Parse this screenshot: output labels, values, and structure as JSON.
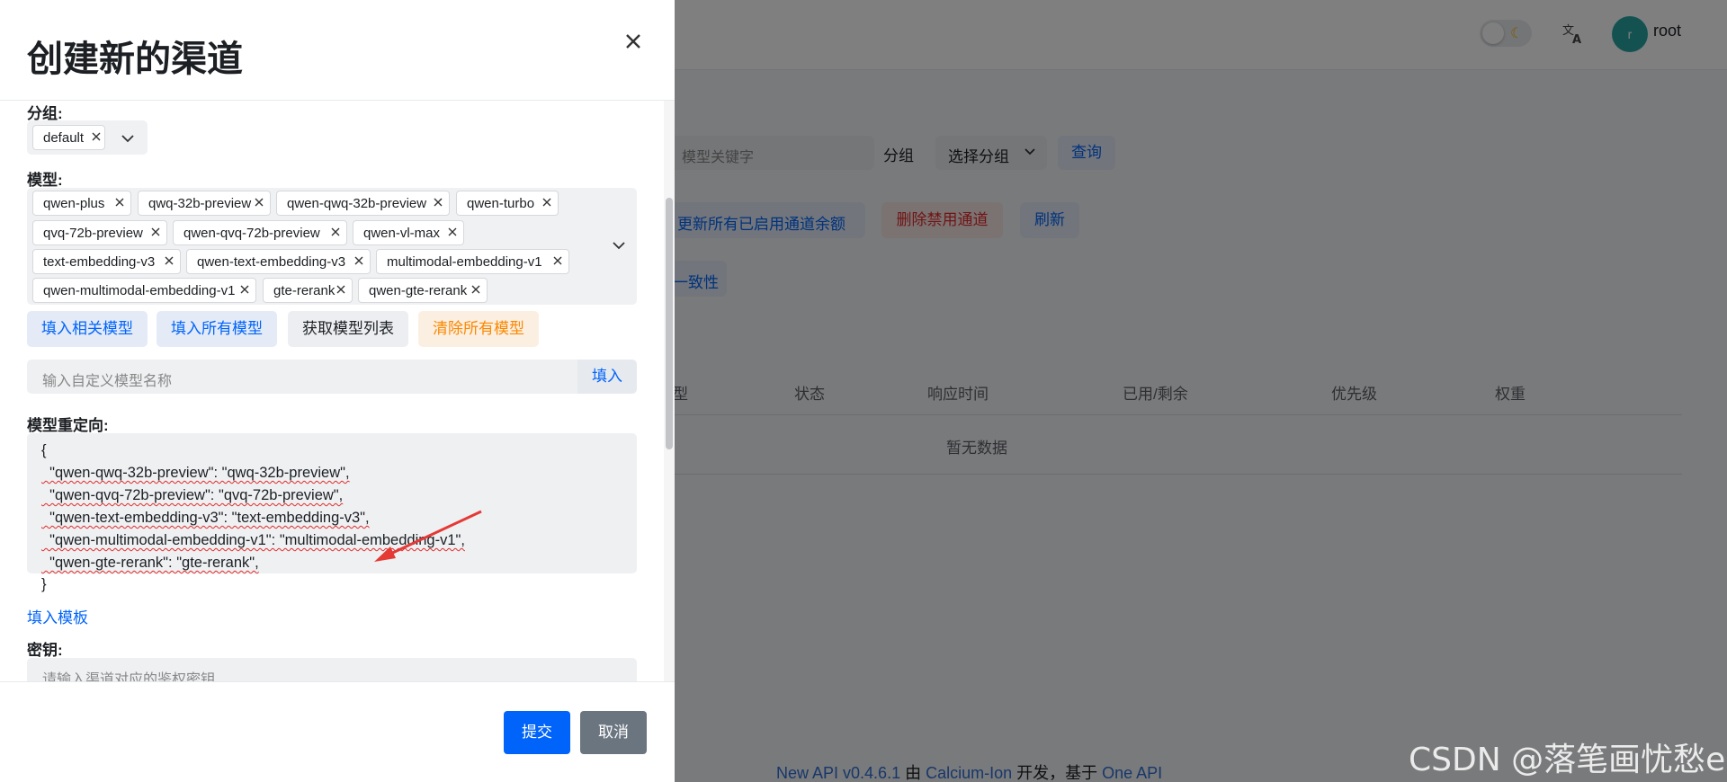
{
  "background": {
    "topbar": {
      "username": "root",
      "avatar_letter": "r"
    },
    "search": {
      "placeholder": "模型关键字",
      "group_label": "分组",
      "group_select": "选择分组",
      "query_button": "查询"
    },
    "actions": {
      "update_balance": "更新所有已启用通道余额",
      "delete_disabled": "删除禁用通道",
      "refresh": "刷新",
      "consistency": "一致性"
    },
    "table": {
      "columns": [
        "型",
        "状态",
        "响应时间",
        "已用/剩余",
        "优先级",
        "权重"
      ],
      "empty_text": "暂无数据"
    },
    "footer": {
      "version": "New API v0.4.6.1",
      "by": " 由 ",
      "author": "Calcium-Ion",
      "dev": " 开发，基于 ",
      "base": "One API"
    }
  },
  "watermark": "CSDN @落笔画忧愁e",
  "sheet": {
    "title": "创建新的渠道",
    "group": {
      "label": "分组:",
      "tags": [
        "default"
      ]
    },
    "models": {
      "label": "模型:",
      "tags": [
        "qwen-plus",
        "qwq-32b-preview",
        "qwen-qwq-32b-preview",
        "qwen-turbo",
        "qvq-72b-preview",
        "qwen-qvq-72b-preview",
        "qwen-vl-max",
        "text-embedding-v3",
        "qwen-text-embedding-v3",
        "multimodal-embedding-v1",
        "qwen-multimodal-embedding-v1",
        "gte-rerank",
        "qwen-gte-rerank"
      ]
    },
    "model_buttons": {
      "fill_related": "填入相关模型",
      "fill_all": "填入所有模型",
      "fetch_list": "获取模型列表",
      "clear_all": "清除所有模型"
    },
    "custom_model": {
      "placeholder": "输入自定义模型名称",
      "fill": "填入"
    },
    "redirect": {
      "label": "模型重定向:",
      "lines": [
        "{",
        "  \"qwen-qwq-32b-preview\": \"qwq-32b-preview\",",
        "  \"qwen-qvq-72b-preview\": \"qvq-72b-preview\",",
        "  \"qwen-text-embedding-v3\": \"text-embedding-v3\",",
        "  \"qwen-multimodal-embedding-v1\": \"multimodal-embedding-v1\",",
        "  \"qwen-gte-rerank\": \"gte-rerank\",",
        "}"
      ],
      "template_link": "填入模板"
    },
    "key": {
      "label": "密钥:",
      "placeholder": "请输入渠道对应的鉴权密钥"
    },
    "footer": {
      "submit": "提交",
      "cancel": "取消"
    }
  },
  "colors": {
    "primary": "#0064fa",
    "danger": "#e02b2b",
    "warning": "#fc8800",
    "secondary": "#6b7580",
    "overlay": "rgba(0,0,0,0.5)",
    "annotation_arrow": "#e53935"
  }
}
